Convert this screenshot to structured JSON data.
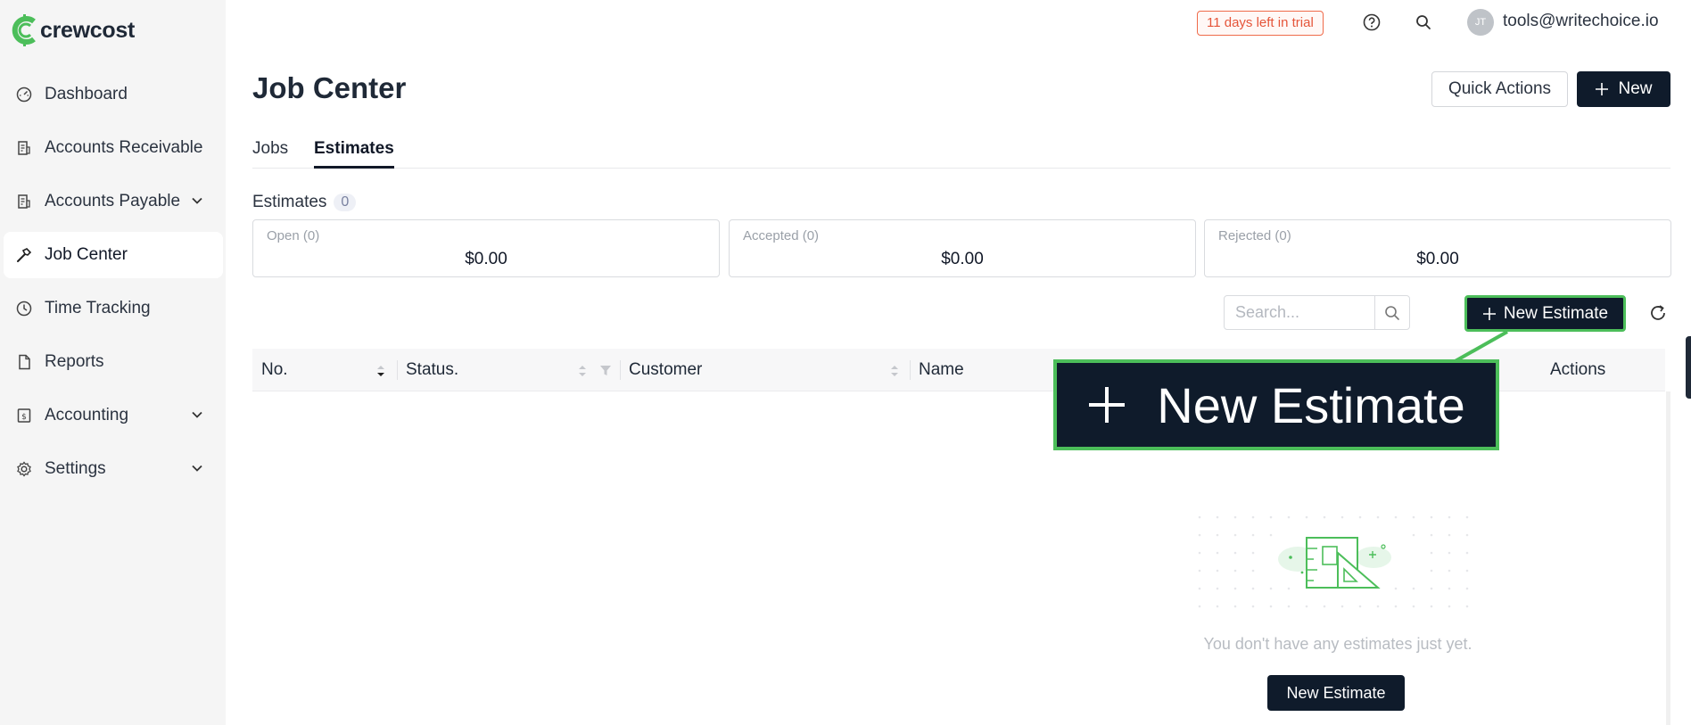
{
  "app": {
    "logo_text": "crewcost"
  },
  "sidebar": {
    "items": [
      {
        "label": "Dashboard",
        "icon": "gauge-icon",
        "active": false,
        "expandable": false
      },
      {
        "label": "Accounts Receivable",
        "icon": "receipt-icon",
        "active": false,
        "expandable": false
      },
      {
        "label": "Accounts Payable",
        "icon": "receipt-icon",
        "active": false,
        "expandable": true
      },
      {
        "label": "Job Center",
        "icon": "hammer-icon",
        "active": true,
        "expandable": false
      },
      {
        "label": "Time Tracking",
        "icon": "clock-icon",
        "active": false,
        "expandable": false
      },
      {
        "label": "Reports",
        "icon": "document-icon",
        "active": false,
        "expandable": false
      },
      {
        "label": "Accounting",
        "icon": "dollar-sheet-icon",
        "active": false,
        "expandable": true
      },
      {
        "label": "Settings",
        "icon": "gear-icon",
        "active": false,
        "expandable": true
      }
    ]
  },
  "topbar": {
    "trial_badge": "11 days left in trial",
    "avatar_initials": "JT",
    "user_email": "tools@writechoice.io"
  },
  "header": {
    "title": "Job Center",
    "quick_actions_label": "Quick Actions",
    "new_label": "New"
  },
  "tabs": [
    {
      "label": "Jobs",
      "active": false
    },
    {
      "label": "Estimates",
      "active": true
    }
  ],
  "estimates": {
    "label": "Estimates",
    "count": "0",
    "cards": [
      {
        "label": "Open (0)",
        "value": "$0.00"
      },
      {
        "label": "Accepted (0)",
        "value": "$0.00"
      },
      {
        "label": "Rejected (0)",
        "value": "$0.00"
      }
    ],
    "search_placeholder": "Search...",
    "new_estimate_label": "New Estimate"
  },
  "table": {
    "columns": [
      "No.",
      "Status.",
      "Customer",
      "Name",
      "Actions"
    ]
  },
  "callout": {
    "label": "New Estimate"
  },
  "empty_state": {
    "text": "You don't have any estimates just yet.",
    "button_label": "New Estimate"
  },
  "colors": {
    "brand_green": "#4cbe5a",
    "dark_navy": "#0f1b2b",
    "trial_orange": "#e5553a"
  }
}
